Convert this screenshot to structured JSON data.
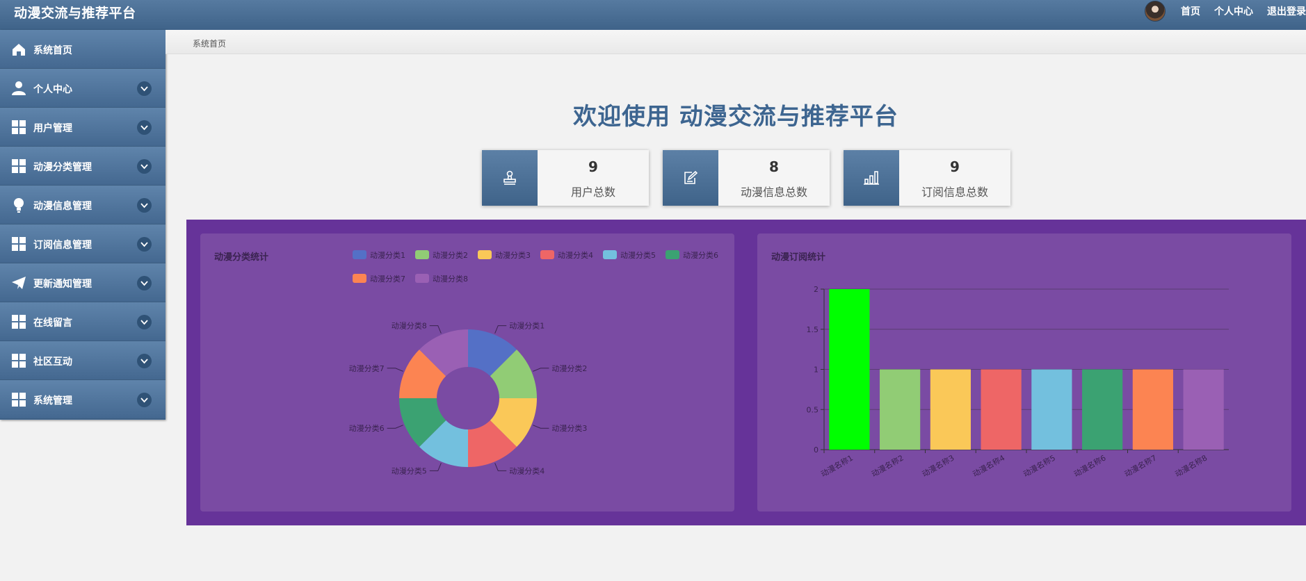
{
  "header": {
    "app_title": "动漫交流与推荐平台",
    "nav": [
      "首页",
      "个人中心",
      "退出登录"
    ]
  },
  "sidebar": {
    "items": [
      {
        "label": "系统首页",
        "icon": "home-icon",
        "expandable": false
      },
      {
        "label": "个人中心",
        "icon": "user-icon",
        "expandable": true
      },
      {
        "label": "用户管理",
        "icon": "grid-icon",
        "expandable": true
      },
      {
        "label": "动漫分类管理",
        "icon": "grid-icon",
        "expandable": true
      },
      {
        "label": "动漫信息管理",
        "icon": "bulb-icon",
        "expandable": true
      },
      {
        "label": "订阅信息管理",
        "icon": "grid-icon",
        "expandable": true
      },
      {
        "label": "更新通知管理",
        "icon": "paper-plane-icon",
        "expandable": true
      },
      {
        "label": "在线留言",
        "icon": "grid-icon",
        "expandable": true
      },
      {
        "label": "社区互动",
        "icon": "grid-icon",
        "expandable": true
      },
      {
        "label": "系统管理",
        "icon": "grid-icon",
        "expandable": true
      }
    ]
  },
  "breadcrumb": "系统首页",
  "welcome": "欢迎使用 动漫交流与推荐平台",
  "stats": [
    {
      "value": "9",
      "label": "用户总数",
      "icon": "stamp-icon"
    },
    {
      "value": "8",
      "label": "动漫信息总数",
      "icon": "edit-icon"
    },
    {
      "value": "9",
      "label": "订阅信息总数",
      "icon": "bar-chart-icon"
    }
  ],
  "colors": {
    "chart_band": "#663399",
    "panel": "#7a4ba3",
    "series": [
      "#5470c6",
      "#91cc75",
      "#fac858",
      "#ee6666",
      "#73c0de",
      "#3ba272",
      "#fc8452",
      "#9a60b4"
    ],
    "first_bar": "#00ff00"
  },
  "chart_data": [
    {
      "type": "pie",
      "variant": "donut",
      "title": "动漫分类统计",
      "legend_position": "top-right",
      "categories": [
        "动漫分类1",
        "动漫分类2",
        "动漫分类3",
        "动漫分类4",
        "动漫分类5",
        "动漫分类6",
        "动漫分类7",
        "动漫分类8"
      ],
      "values": [
        1,
        1,
        1,
        1,
        1,
        1,
        1,
        1
      ]
    },
    {
      "type": "bar",
      "title": "动漫订阅统计",
      "categories": [
        "动漫名称1",
        "动漫名称2",
        "动漫名称3",
        "动漫名称4",
        "动漫名称5",
        "动漫名称6",
        "动漫名称7",
        "动漫名称8"
      ],
      "values": [
        2,
        1,
        1,
        1,
        1,
        1,
        1,
        1
      ],
      "ylim": [
        0,
        2
      ],
      "yticks": [
        "0",
        "0.5",
        "1",
        "1.5",
        "2"
      ],
      "grid": true
    }
  ]
}
